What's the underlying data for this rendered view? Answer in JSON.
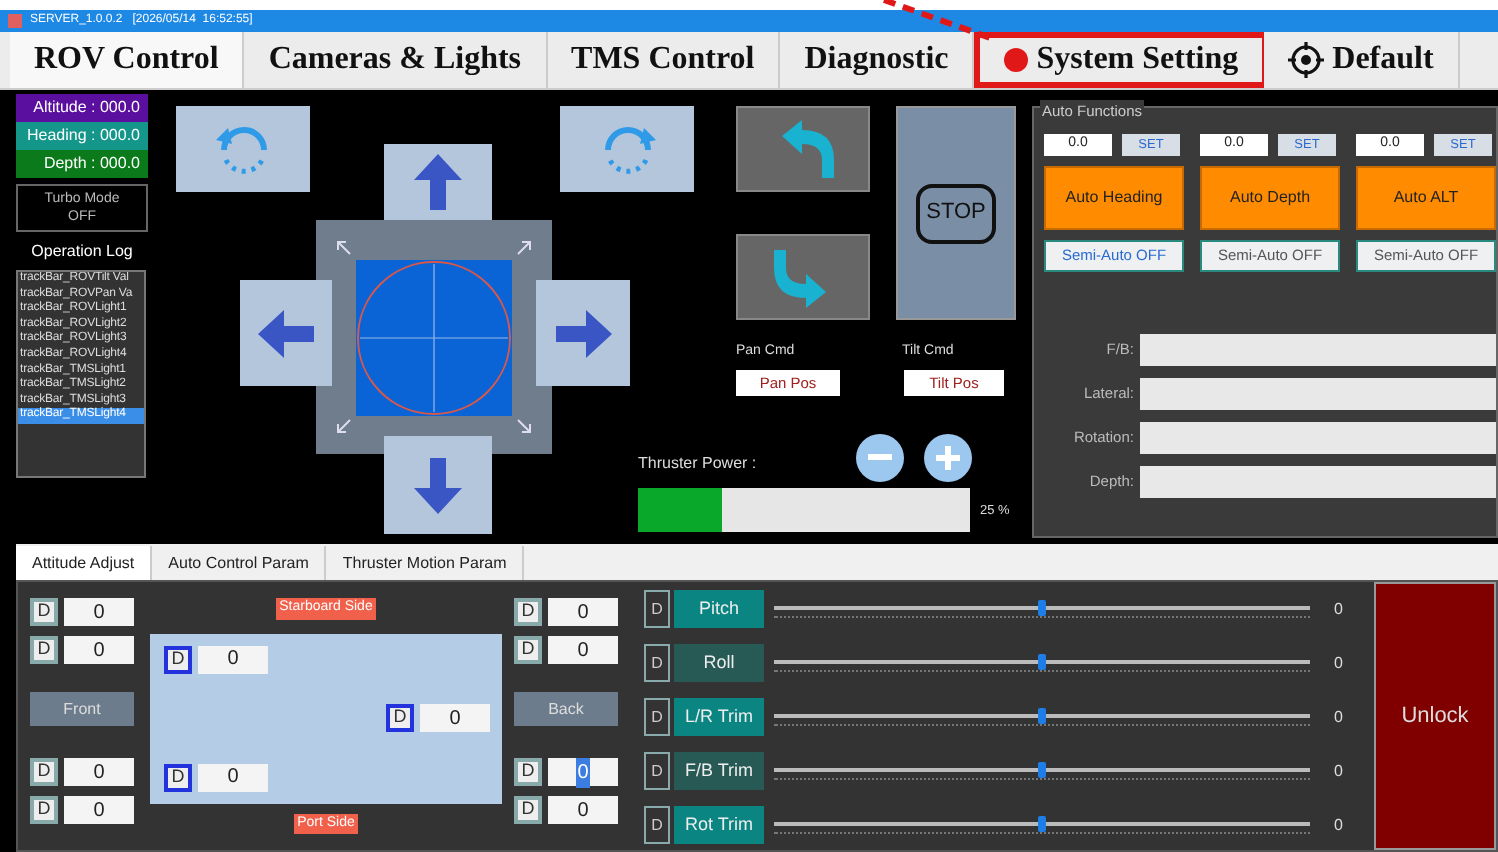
{
  "window": {
    "title": "SERVER_1.0.0.2   [2026/05/14  16:52:55]"
  },
  "main_tabs": [
    {
      "label": "ROV Control",
      "selected": true,
      "highlighted": false,
      "kind": "text"
    },
    {
      "label": "Cameras & Lights",
      "selected": false,
      "highlighted": false,
      "kind": "text"
    },
    {
      "label": "TMS Control",
      "selected": false,
      "highlighted": false,
      "kind": "text"
    },
    {
      "label": "Diagnostic",
      "selected": false,
      "highlighted": false,
      "kind": "text"
    },
    {
      "label": "System Setting",
      "selected": false,
      "highlighted": true,
      "kind": "text"
    },
    {
      "label": "Default",
      "selected": false,
      "highlighted": false,
      "kind": "target"
    }
  ],
  "readouts": [
    {
      "text": "Altitude : 000.0",
      "color": "#5a0f9e"
    },
    {
      "text": "Heading : 000.0",
      "color": "#14968a"
    },
    {
      "text": "Depth : 000.0",
      "color": "#0b7a1a"
    }
  ],
  "turbo_mode": {
    "label": "Turbo Mode",
    "value": "OFF"
  },
  "operation_log": {
    "title": "Operation Log",
    "items": [
      {
        "text": "trackBar_ROVTilt Val",
        "selected": false
      },
      {
        "text": "trackBar_ROVPan Va",
        "selected": false
      },
      {
        "text": "trackBar_ROVLight1",
        "selected": false
      },
      {
        "text": "trackBar_ROVLight2",
        "selected": false
      },
      {
        "text": "trackBar_ROVLight3",
        "selected": false
      },
      {
        "text": "trackBar_ROVLight4",
        "selected": false
      },
      {
        "text": "trackBar_TMSLight1",
        "selected": false
      },
      {
        "text": "trackBar_TMSLight2",
        "selected": false
      },
      {
        "text": "trackBar_TMSLight3",
        "selected": false
      },
      {
        "text": "trackBar_TMSLight4",
        "selected": true
      }
    ]
  },
  "stop": "STOP",
  "pan": {
    "label": "Pan Cmd",
    "value": "Pan Pos"
  },
  "tilt": {
    "label": "Tilt Cmd",
    "value": "Tilt Pos"
  },
  "thruster_power": {
    "label": "Thruster Power :",
    "level": 0.25,
    "reading": "25 %"
  },
  "auto_functions": {
    "title": "Auto Functions",
    "modes": [
      {
        "setpoint": "0.0",
        "set": "SET",
        "button": "Auto Heading",
        "semi_auto": "Semi-Auto OFF",
        "focused": true
      },
      {
        "setpoint": "0.0",
        "set": "SET",
        "button": "Auto Depth",
        "semi_auto": "Semi-Auto OFF",
        "focused": false
      },
      {
        "setpoint": "0.0",
        "set": "SET",
        "button": "Auto ALT",
        "semi_auto": "Semi-Auto OFF",
        "focused": false
      }
    ],
    "outputs": [
      {
        "label": "F/B:"
      },
      {
        "label": "Lateral:"
      },
      {
        "label": "Rotation:"
      },
      {
        "label": "Depth:"
      }
    ]
  },
  "bottom_tabs": [
    {
      "label": "Attitude Adjust",
      "selected": true
    },
    {
      "label": "Auto Control Param",
      "selected": false
    },
    {
      "label": "Thruster Motion Param",
      "selected": false
    }
  ],
  "attitude": {
    "starboard": "Starboard Side",
    "port": "Port Side",
    "front": "Front",
    "back": "Back",
    "left_fields": [
      {
        "d": "D",
        "value": "0",
        "focused": false
      },
      {
        "d": "D",
        "value": "0",
        "focused": false
      },
      {
        "d": "D",
        "value": "0",
        "focused": false
      },
      {
        "d": "D",
        "value": "0",
        "focused": false
      }
    ],
    "right_fields": [
      {
        "d": "D",
        "value": "0",
        "focused": false
      },
      {
        "d": "D",
        "value": "0",
        "focused": false
      },
      {
        "d": "D",
        "value": "0",
        "focused": true
      },
      {
        "d": "D",
        "value": "0",
        "focused": false
      }
    ],
    "inner_fields": [
      {
        "d": "D",
        "value": "0"
      },
      {
        "d": "D",
        "value": "0"
      },
      {
        "d": "D",
        "value": "0"
      }
    ]
  },
  "trims": [
    {
      "d": "D",
      "label": "Pitch",
      "color": "#0b8582",
      "level": 0.5,
      "reading": "0"
    },
    {
      "d": "D",
      "label": "Roll",
      "color": "#275a55",
      "level": 0.5,
      "reading": "0"
    },
    {
      "d": "D",
      "label": "L/R Trim",
      "color": "#0b8582",
      "level": 0.5,
      "reading": "0"
    },
    {
      "d": "D",
      "label": "F/B Trim",
      "color": "#275a55",
      "level": 0.5,
      "reading": "0"
    },
    {
      "d": "D",
      "label": "Rot Trim",
      "color": "#0b8582",
      "level": 0.5,
      "reading": "0"
    }
  ],
  "unlock": "Unlock"
}
